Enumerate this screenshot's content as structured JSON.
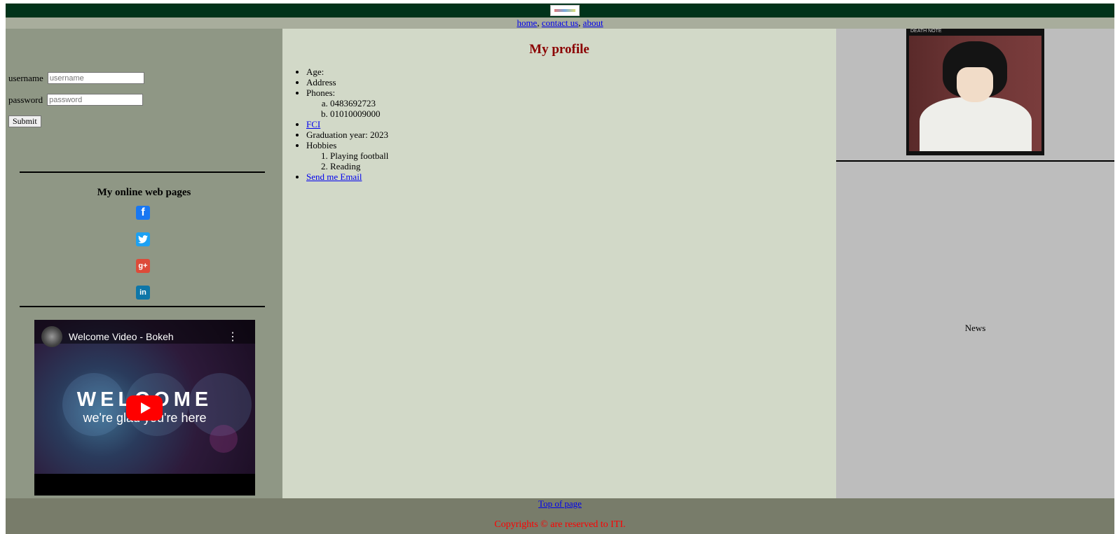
{
  "header": {
    "logo_icon": "logo-icon"
  },
  "nav": {
    "links": [
      "home",
      "contact us",
      "about"
    ],
    "separator": ", "
  },
  "login": {
    "username_label": "username",
    "username_placeholder": "username",
    "password_label": "password",
    "password_placeholder": "password",
    "submit_label": "Submit"
  },
  "online": {
    "title": "My online web pages",
    "icons": [
      "facebook-icon",
      "twitter-icon",
      "google-plus-icon",
      "linkedin-icon"
    ]
  },
  "video": {
    "title": "Welcome Video - Bokeh",
    "headline": "WELCOME",
    "subline": "we're glad you're here"
  },
  "profile": {
    "title": "My profile",
    "age": "Age:",
    "address": "Address",
    "phones_label": "Phones:",
    "phones": [
      "0483692723",
      "01010009000"
    ],
    "fci": "FCI",
    "graduation": "Graduation year: 2023",
    "hobbies_label": "Hobbies",
    "hobbies": [
      "Playing football",
      "Reading"
    ],
    "email_link": "Send me Email"
  },
  "side": {
    "image_caption": "DEATH NOTE",
    "news": "News"
  },
  "footer": {
    "top_link": "Top of page",
    "copyright": "Copyrights © are reserved to ITI."
  },
  "colors": {
    "topbar": "#01331a",
    "navbar": "#a8ad9c",
    "left_panel": "#8f9785",
    "center_panel": "#d2d9c8",
    "right_panel": "#bdbdbd",
    "footer": "#787c6a",
    "profile_title": "#8b0000",
    "copyright": "#ff0000"
  }
}
